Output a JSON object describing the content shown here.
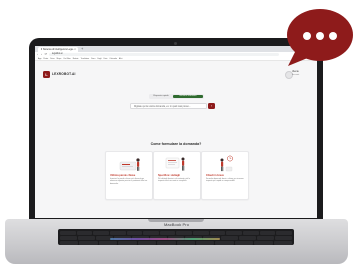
{
  "browser": {
    "tab_title": "Il Sistema di Intelligenza Lega...",
    "tab_close": "×",
    "new_tab": "+",
    "nav_icons": "‹ › ⟳",
    "url": "legalbot.ai",
    "bookmarks": [
      "App",
      "Posta",
      "Drive",
      "Maps",
      "YouTube",
      "Notizie",
      "Traduttore",
      "Docs",
      "Fogli",
      "Foto",
      "Calendar",
      "Altri"
    ]
  },
  "header": {
    "logo_letter": "L",
    "logo_text": "LEXROBOT.AI",
    "user_name": "Utente",
    "user_role": "Account"
  },
  "mode_toggle": {
    "option_a": "Risposta rapida",
    "option_b": "Ricerca avanzata"
  },
  "search": {
    "placeholder": "Digitate qui la vostra domanda, es: in quali casi posso...",
    "button_icon": "›"
  },
  "section": {
    "title": "Come formulare la domanda?"
  },
  "cards": [
    {
      "title": "Utilizza parole chiave",
      "desc": "Inserisci le parole chiave più rilevanti per ottenere risposte precise e pertinenti alla tua domanda.",
      "accent": "#c0392b"
    },
    {
      "title": "Specifica i dettagli",
      "desc": "Più dettagli fornisci sul contesto, più la risposta sarà accurata e completa.",
      "accent": "#c0392b"
    },
    {
      "title": "Chiedi in breve",
      "desc": "Formula domande brevi e chiare per ricevere risposte più rapide e comprensibili.",
      "accent": "#c0392b"
    }
  ],
  "device": {
    "model": "MacBook Pro"
  },
  "chat_bubble": {
    "icon": "chat-bubble-icon",
    "color": "#8e1b1b"
  },
  "colors": {
    "brand": "#8e1b1b",
    "toggle_active": "#2f6b2f"
  }
}
